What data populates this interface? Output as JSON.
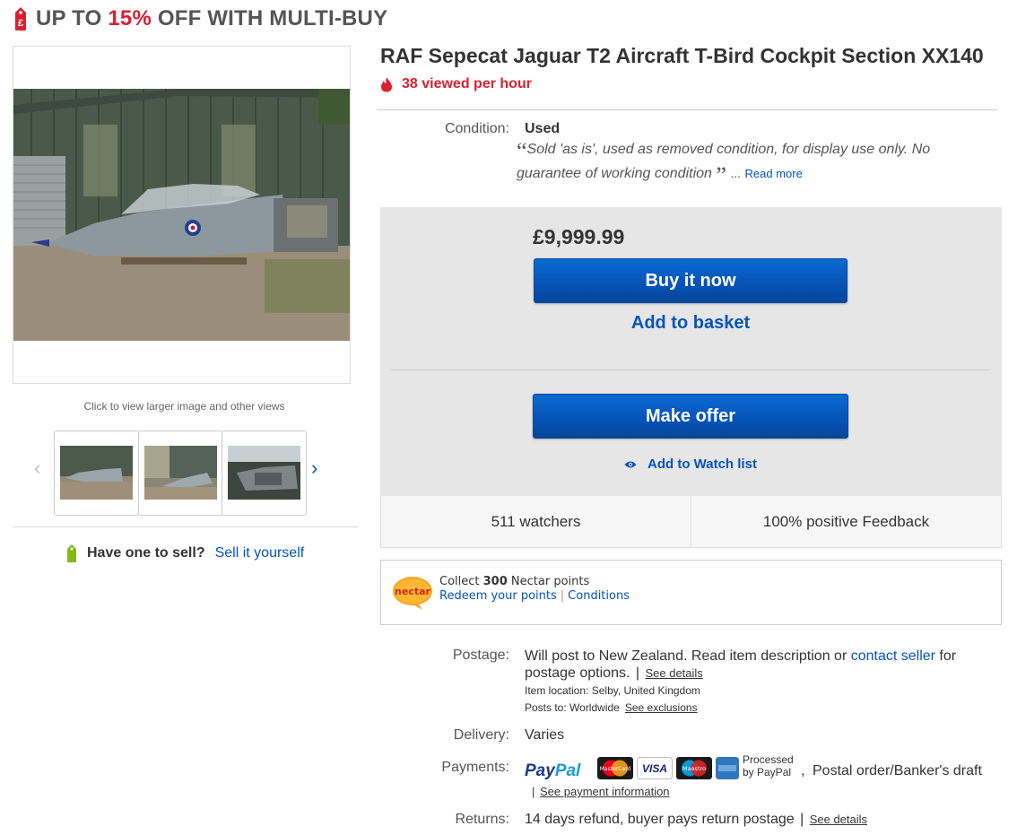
{
  "promo": {
    "prefix": "UP TO ",
    "percent": "15%",
    "suffix": " OFF WITH MULTI-BUY",
    "icon": "price-tag-icon",
    "accent_color": "#dd1e31"
  },
  "gallery": {
    "hint": "Click to view larger image and other views",
    "prev_icon": "chevron-left-icon",
    "next_icon": "chevron-right-icon",
    "thumbnails": 3
  },
  "sell": {
    "question": "Have one to sell?",
    "link": "Sell it yourself",
    "icon": "green-tag-icon"
  },
  "item": {
    "title": "RAF Sepecat Jaguar T2 Aircraft T-Bird Cockpit Section XX140",
    "viewed": "38 viewed per hour",
    "viewed_icon": "flame-icon",
    "condition_label": "Condition:",
    "condition_value": "Used",
    "condition_desc": "Sold 'as is', used as removed condition, for display use only. No guarantee of working condition",
    "ellipsis": "...",
    "read_more": "Read more"
  },
  "buybox": {
    "price": "£9,999.99",
    "buy_now": "Buy it now",
    "add_basket": "Add to basket",
    "make_offer": "Make offer",
    "watch": "Add to Watch list",
    "watch_icon": "eye-icon",
    "watchers": "511 watchers",
    "feedback": "100% positive Feedback"
  },
  "nectar": {
    "logo_text": "nectar",
    "collect_prefix": "Collect ",
    "points": "300",
    "collect_suffix": " Nectar points",
    "redeem": "Redeem your points",
    "separator": "|",
    "conditions": "Conditions"
  },
  "details": {
    "postage_label": "Postage:",
    "postage_text1": "Will post to New Zealand. Read item description or ",
    "contact_seller": "contact seller",
    "postage_text2": " for postage options.",
    "bar": "|",
    "see_details": "See details",
    "location_label": "Item location:",
    "location_value": "Selby, United Kingdom",
    "posts_to_label": "Posts to:",
    "posts_to_value": "Worldwide",
    "see_exclusions": "See exclusions",
    "delivery_label": "Delivery:",
    "delivery_value": "Varies",
    "payments_label": "Payments:",
    "paypal_a": "Pay",
    "paypal_b": "Pal",
    "card_visa": "VISA",
    "card_mastercard": "MasterCard",
    "card_maestro": "Maestro",
    "processed_1": "Processed",
    "processed_2": "by PayPal",
    "comma": ",",
    "other_payment": "Postal order/Banker's draft",
    "payment_info": "See payment information",
    "returns_label": "Returns:",
    "returns_value": "14 days refund, buyer pays return postage",
    "returns_details": "See details"
  }
}
